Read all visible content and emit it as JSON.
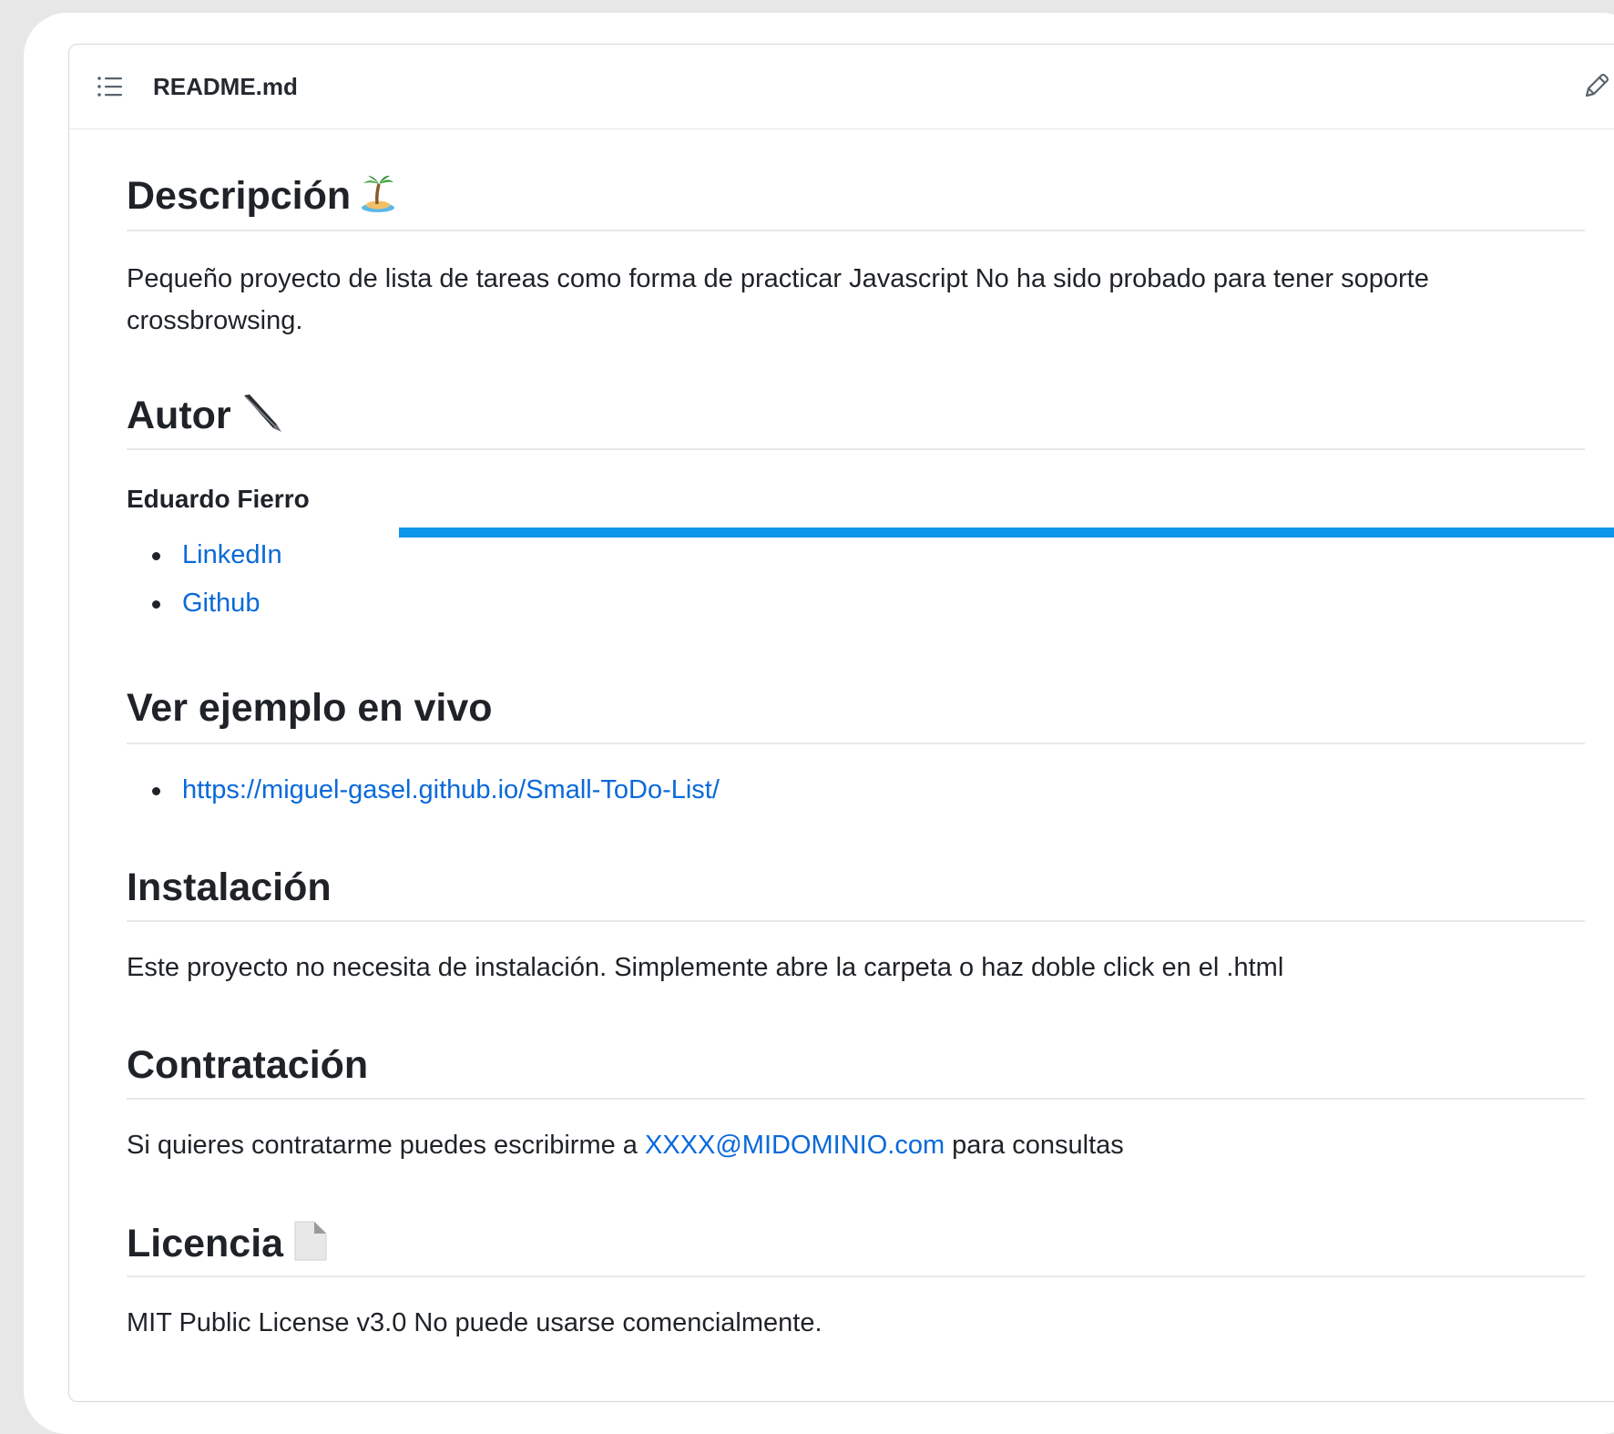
{
  "file": {
    "name": "README.md"
  },
  "sections": {
    "descripcion": {
      "title": "Descripción",
      "text_line1": "Pequeño proyecto de lista de tareas como forma de practicar Javascript No ha sido probado para tener soporte",
      "text_line2": "crossbrowsing."
    },
    "autor": {
      "title": "Autor",
      "name": "Eduardo Fierro",
      "links": [
        "LinkedIn",
        "Github"
      ]
    },
    "ejemplo": {
      "title": "Ver ejemplo en vivo",
      "link": "https://miguel-gasel.github.io/Small-ToDo-List/"
    },
    "instalacion": {
      "title": "Instalación",
      "text": "Este proyecto no necesita de instalación. Simplemente abre la carpeta o haz doble click en el .html"
    },
    "contratacion": {
      "title": "Contratación",
      "text_before": "Si quieres contratarme puedes escribirme a ",
      "email": "XXXX@MIDOMINIO.com",
      "text_after": " para consultas"
    },
    "licencia": {
      "title": "Licencia",
      "text": "MIT Public License v3.0 No puede usarse comencialmente."
    }
  },
  "colors": {
    "link": "#0969da",
    "overlay_bar": "#0a96eb"
  },
  "icons": {
    "header_left": "list-icon",
    "header_right": "pencil-icon",
    "descripcion": "island-icon",
    "autor": "pen-icon",
    "licencia": "document-icon"
  }
}
